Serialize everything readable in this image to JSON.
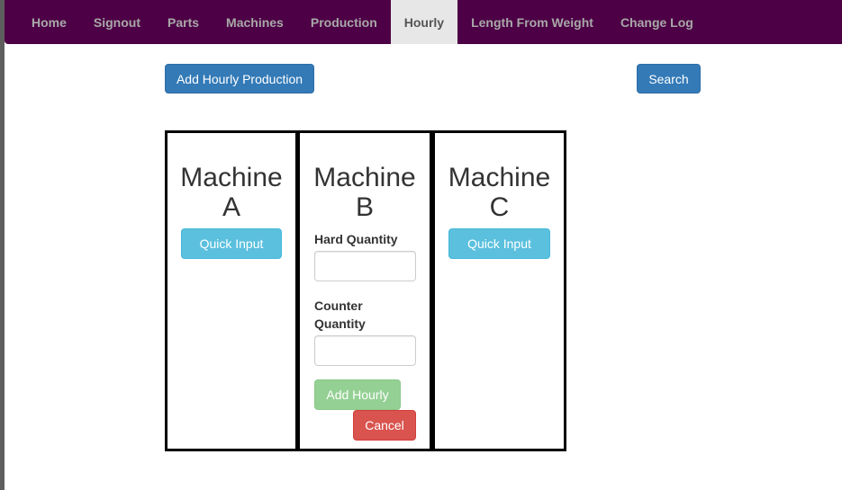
{
  "nav": {
    "items": [
      {
        "label": "Home",
        "active": false
      },
      {
        "label": "Signout",
        "active": false
      },
      {
        "label": "Parts",
        "active": false
      },
      {
        "label": "Machines",
        "active": false
      },
      {
        "label": "Production",
        "active": false
      },
      {
        "label": "Hourly",
        "active": true
      },
      {
        "label": "Length From Weight",
        "active": false
      },
      {
        "label": "Change Log",
        "active": false
      }
    ]
  },
  "toolbar": {
    "add_label": "Add Hourly Production",
    "search_label": "Search"
  },
  "machines": [
    {
      "name_line1": "Machine",
      "name_line2": "A",
      "quick_input_label": "Quick Input"
    },
    {
      "name_line1": "Machine",
      "name_line2": "B",
      "hard_quantity_label": "Hard Quantity",
      "hard_quantity_value": "",
      "counter_quantity_label_line1": "Counter",
      "counter_quantity_label_line2": "Quantity",
      "counter_quantity_value": "",
      "add_hourly_label": "Add Hourly",
      "cancel_label": "Cancel"
    },
    {
      "name_line1": "Machine",
      "name_line2": "C",
      "quick_input_label": "Quick Input"
    }
  ],
  "colors": {
    "navbar": "#4d0045",
    "primary": "#337ab7",
    "info": "#5bc0de",
    "success": "#5cb85c",
    "danger": "#d9534f"
  }
}
